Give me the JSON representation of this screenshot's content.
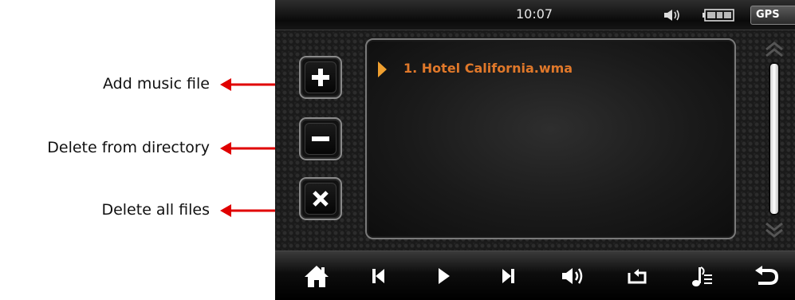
{
  "annotations": [
    {
      "label": "Add music file"
    },
    {
      "label": "Delete from directory"
    },
    {
      "label": "Delete all files"
    }
  ],
  "status_bar": {
    "time": "10:07",
    "volume_icon": "speaker-icon",
    "battery_icon": "battery-icon",
    "gps_label": "GPS"
  },
  "side_buttons": [
    {
      "name": "add-music-button",
      "icon": "plus-icon"
    },
    {
      "name": "delete-from-directory-button",
      "icon": "minus-icon"
    },
    {
      "name": "delete-all-button",
      "icon": "close-icon"
    }
  ],
  "playlist": {
    "tracks": [
      {
        "title": "1. Hotel California.wma",
        "playing": true
      }
    ]
  },
  "scrollbar": {
    "up_icon": "chevron-up-icon",
    "down_icon": "chevron-down-icon"
  },
  "toolbar": {
    "buttons": [
      {
        "name": "home-button",
        "icon": "home-icon"
      },
      {
        "name": "previous-button",
        "icon": "skip-previous-icon"
      },
      {
        "name": "play-button",
        "icon": "play-icon"
      },
      {
        "name": "next-button",
        "icon": "skip-next-icon"
      },
      {
        "name": "volume-button",
        "icon": "speaker-icon"
      },
      {
        "name": "repeat-button",
        "icon": "repeat-icon"
      },
      {
        "name": "playlist-button",
        "icon": "playlist-icon"
      },
      {
        "name": "back-button",
        "icon": "return-icon"
      }
    ]
  },
  "colors": {
    "accent": "#e0782a",
    "annotation_arrow": "#e00000"
  }
}
